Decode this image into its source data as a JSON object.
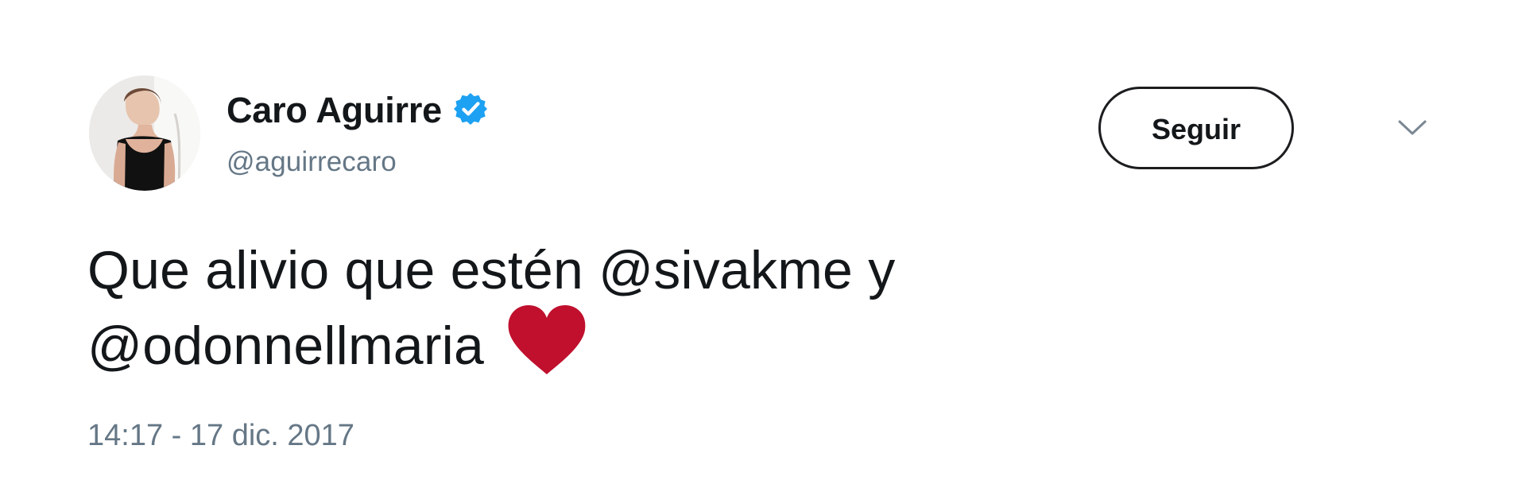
{
  "user": {
    "display_name": "Caro Aguirre",
    "handle": "@aguirrecaro",
    "verified": true,
    "avatar_icon": "avatar-photo",
    "verified_icon": "verified-badge-icon",
    "verified_color": "#1da1f2"
  },
  "actions": {
    "follow_label": "Seguir",
    "menu_icon": "chevron-down-icon"
  },
  "tweet": {
    "text_1": "Que alivio que estén",
    "mention_1": "@sivakme",
    "text_2": "y",
    "mention_2": "@odonnellmaria",
    "emoji_icon": "red-heart-icon",
    "emoji_color": "#c0102d"
  },
  "meta": {
    "timestamp": "14:17 - 17 dic. 2017"
  }
}
